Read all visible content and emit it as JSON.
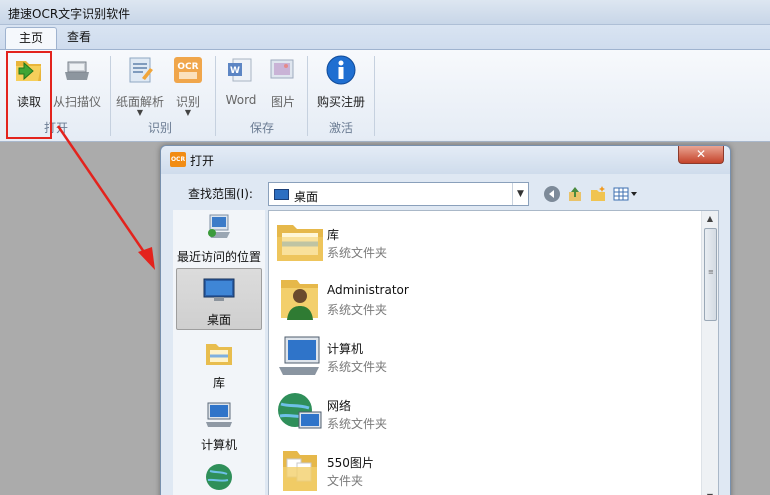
{
  "app": {
    "title": "捷速OCR文字识别软件",
    "tabs": [
      {
        "label": "主页",
        "active": true
      },
      {
        "label": "查看",
        "active": false
      }
    ]
  },
  "ribbon": {
    "buttons": [
      {
        "label": "读取",
        "icon": "folder-open-icon"
      },
      {
        "label": "从扫描仪",
        "icon": "scanner-icon"
      },
      {
        "label": "纸面解析",
        "icon": "page-analysis-icon"
      },
      {
        "label": "识别",
        "icon": "ocr-icon"
      },
      {
        "label": "Word",
        "icon": "word-icon"
      },
      {
        "label": "图片",
        "icon": "image-icon"
      },
      {
        "label": "购买注册",
        "icon": "info-icon"
      }
    ],
    "groups": [
      "打开",
      "识别",
      "保存",
      "激活"
    ]
  },
  "dialog": {
    "title": "打开",
    "close_label": "✕",
    "lookin_label": "查找范围(I):",
    "lookin_value": "桌面",
    "places": [
      {
        "label": "最近访问的位置",
        "icon": "recent-places-icon",
        "selected": false
      },
      {
        "label": "桌面",
        "icon": "desktop-icon",
        "selected": true
      },
      {
        "label": "库",
        "icon": "library-icon",
        "selected": false
      },
      {
        "label": "计算机",
        "icon": "computer-icon",
        "selected": false
      }
    ],
    "files": [
      {
        "name": "库",
        "type": "系统文件夹",
        "icon": "library-folder-icon"
      },
      {
        "name": "Administrator",
        "type": "系统文件夹",
        "icon": "user-folder-icon"
      },
      {
        "name": "计算机",
        "type": "系统文件夹",
        "icon": "computer-icon"
      },
      {
        "name": "网络",
        "type": "系统文件夹",
        "icon": "network-icon"
      },
      {
        "name": "550图片",
        "type": "文件夹",
        "icon": "folder-icon"
      }
    ]
  },
  "colors": {
    "highlight": "#e3231d",
    "ribbon_bg": "#e5ecf5",
    "workarea": "#ababab"
  }
}
